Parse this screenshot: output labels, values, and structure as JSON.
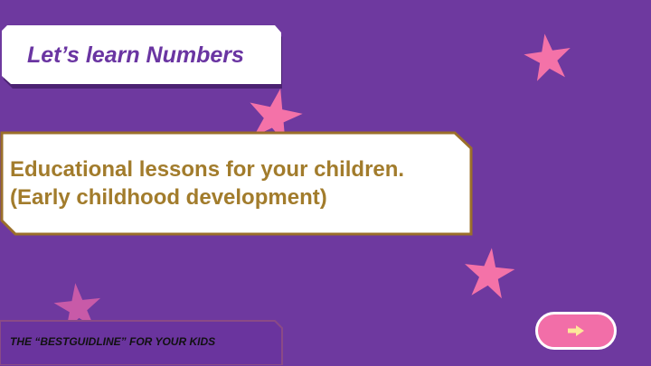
{
  "slide": {
    "title": "Let’s learn Numbers",
    "subtitle_lines": [
      "Educational lessons for your children.",
      "(Early childhood development)"
    ],
    "footer": "THE “BESTGUIDLINE” FOR YOUR KIDS"
  },
  "navigation": {
    "next_icon": "arrow-right-icon"
  },
  "colors": {
    "background": "#6e399f",
    "title_text": "#6a35a2",
    "subtitle_text": "#a27c2c",
    "accent_pink": "#f472a8",
    "box_border": "#9b6f2a"
  }
}
